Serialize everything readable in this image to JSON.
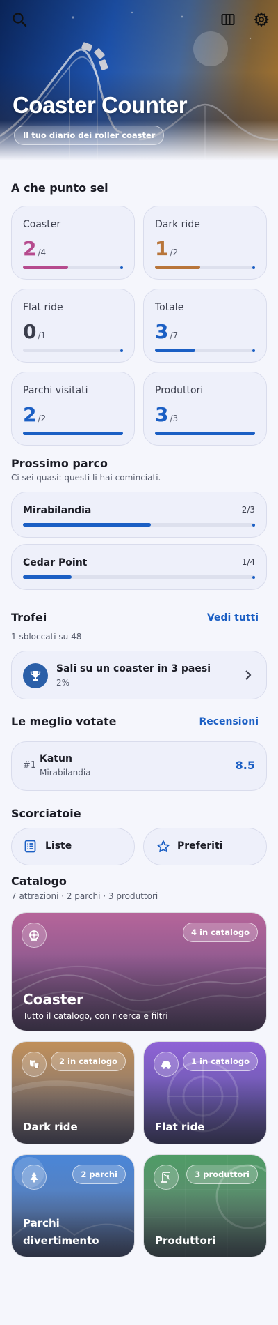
{
  "hero": {
    "title": "Coaster Counter",
    "subtitle": "Il tuo diario dei roller coaster",
    "icons": {
      "search": "search-icon",
      "columns": "columns-icon",
      "settings": "gear-icon"
    }
  },
  "progress": {
    "title": "A che punto sei",
    "cards": [
      {
        "label": "Coaster",
        "value": "2",
        "total": "/4",
        "fraction": 0.5,
        "color": "#b64b8e"
      },
      {
        "label": "Dark ride",
        "value": "1",
        "total": "/2",
        "fraction": 0.5,
        "color": "#b8753a"
      },
      {
        "label": "Flat ride",
        "value": "0",
        "total": "/1",
        "fraction": 0.0,
        "color": "#3b3e4c"
      },
      {
        "label": "Totale",
        "value": "3",
        "total": "/7",
        "fraction": 0.43,
        "color": "#1b5fc4"
      },
      {
        "label": "Parchi visitati",
        "value": "2",
        "total": "/2",
        "fraction": 1.0,
        "color": "#1b5fc4"
      },
      {
        "label": "Produttori",
        "value": "3",
        "total": "/3",
        "fraction": 1.0,
        "color": "#1b5fc4"
      }
    ]
  },
  "next_park": {
    "title": "Prossimo parco",
    "subtitle": "Ci sei quasi: questi li hai cominciati.",
    "parks": [
      {
        "name": "Mirabilandia",
        "count": "2/3",
        "fraction": 0.67
      },
      {
        "name": "Cedar Point",
        "count": "1/4",
        "fraction": 0.25
      }
    ]
  },
  "trophies": {
    "title": "Trofei",
    "link": "Vedi tutti",
    "subtitle": "1 sbloccati su 48",
    "item": {
      "name": "Sali su un coaster in 3 paesi",
      "percent": "2%",
      "icon": "trophy-icon"
    }
  },
  "top_rated": {
    "title": "Le meglio votate",
    "link": "Recensioni",
    "item": {
      "rank": "#1",
      "name": "Katun",
      "park": "Mirabilandia",
      "score": "8.5"
    }
  },
  "shortcuts": {
    "title": "Scorciatoie",
    "items": [
      {
        "label": "Liste",
        "icon": "list-icon"
      },
      {
        "label": "Preferiti",
        "icon": "star-icon"
      }
    ]
  },
  "catalog": {
    "title": "Catalogo",
    "subtitle": "7 attrazioni · 2 parchi · 3 produttori",
    "tiles": [
      {
        "title": "Coaster",
        "desc": "Tutto il catalogo, con ricerca e filtri",
        "badge": "4 in catalogo",
        "icon": "coaster-icon",
        "color": "#b6659a"
      },
      {
        "title": "Dark ride",
        "badge": "2 in catalogo",
        "icon": "theater-masks-icon",
        "color": "#b98a55"
      },
      {
        "title": "Flat ride",
        "badge": "1 in catalogo",
        "icon": "ride-car-icon",
        "color": "#8a5fd1"
      },
      {
        "title_line1": "Parchi",
        "title_line2": "divertimento",
        "badge": "2 parchi",
        "icon": "tree-icon",
        "color": "#4a7fd0"
      },
      {
        "title": "Produttori",
        "badge": "3 produttori",
        "icon": "crane-icon",
        "color": "#4f9a63"
      }
    ]
  }
}
